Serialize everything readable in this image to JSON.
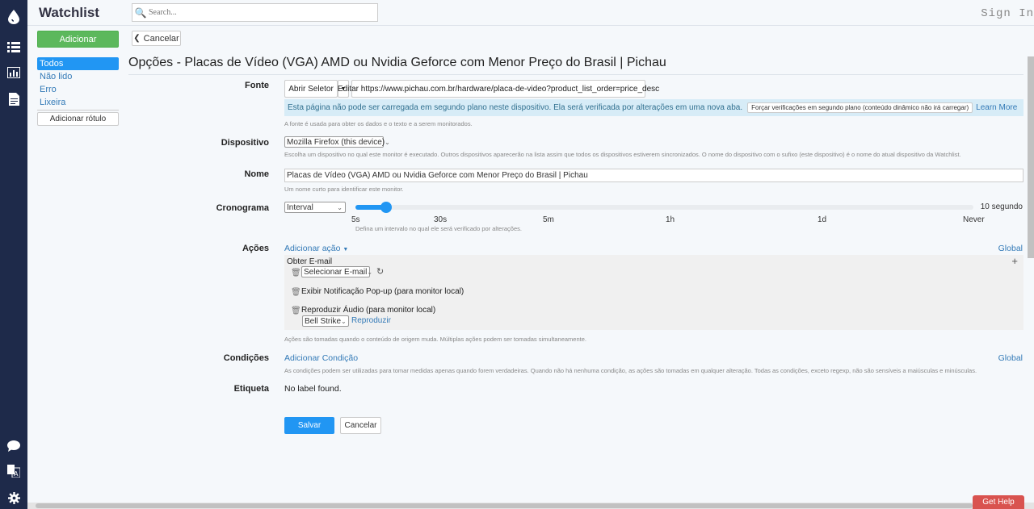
{
  "app": {
    "brand": "Watchlist",
    "sign_in": "Sign In"
  },
  "search": {
    "placeholder": "Search..."
  },
  "sidebar": {
    "add_label": "Adicionar",
    "items": [
      {
        "label": "Todos",
        "active": true
      },
      {
        "label": "Não lido"
      },
      {
        "label": "Erro"
      },
      {
        "label": "Lixeira"
      }
    ],
    "add_label_button": "Adicionar rótulo"
  },
  "toolbar": {
    "cancel_label": "Cancelar"
  },
  "page": {
    "title": "Opções - Placas de Vídeo (VGA) AMD ou Nvidia Geforce com Menor Preço do Brasil | Pichau"
  },
  "form": {
    "source": {
      "label": "Fonte",
      "open_selector": "Abrir Seletor",
      "edit_url": "Editar https://www.pichau.com.br/hardware/placa-de-video?product_list_order=price_desc",
      "info_text": "Esta página não pode ser carregada em segundo plano neste dispositivo. Ela será verificada por alterações em uma nova aba.",
      "force_button": "Forçar verificações em segundo plano (conteúdo dinâmico não irá carregar)",
      "learn_more": "Learn More",
      "help": "A fonte é usada para obter os dados e o texto e a serem monitorados."
    },
    "device": {
      "label": "Dispositivo",
      "value": "Mozilla Firefox (this device)",
      "help": "Escolha um dispositivo no qual este monitor é executado. Outros dispositivos aparecerão na lista assim que todos os dispositivos estiverem sincronizados. O nome do dispositivo com o sufixo (este dispositivo) é o nome do atual dispositivo da Watchlist."
    },
    "name": {
      "label": "Nome",
      "value": "Placas de Vídeo (VGA) AMD ou Nvidia Geforce com Menor Preço do Brasil | Pichau",
      "help": "Um nome curto para identificar este monitor."
    },
    "schedule": {
      "label": "Cronograma",
      "type": "Interval",
      "ticks": [
        "5s",
        "30s",
        "5m",
        "1h",
        "1d",
        "Never"
      ],
      "value_text": "10 segundo",
      "slider_fraction": 0.05,
      "help": "Defina um intervalo no qual ele será verificado por alterações."
    },
    "actions": {
      "label": "Ações",
      "add_action": "Adicionar ação",
      "global": "Global",
      "email_title": "Obter E-mail",
      "email_select": "Selecionar E-mail",
      "popup": "Exibir Notificação Pop-up (para monitor local)",
      "audio": "Reproduzir Áudio (para monitor local)",
      "audio_select": "Bell Strike",
      "play": "Reproduzir",
      "help": "Ações são tomadas quando o conteúdo de origem muda. Múltiplas ações podem ser tomadas simultaneamente."
    },
    "conditions": {
      "label": "Condições",
      "add": "Adicionar Condição",
      "global": "Global",
      "help": "As condições podem ser utilizadas para tomar medidas apenas quando forem verdadeiras. Quando não há nenhuma condição, as ações são tomadas em qualquer alteração. Todas as condições, exceto regexp, não são sensíveis a maiúsculas e minúsculas."
    },
    "tag": {
      "label": "Etiqueta",
      "value": "No label found."
    },
    "save": "Salvar",
    "cancel": "Cancelar"
  },
  "help_button": "Get Help"
}
